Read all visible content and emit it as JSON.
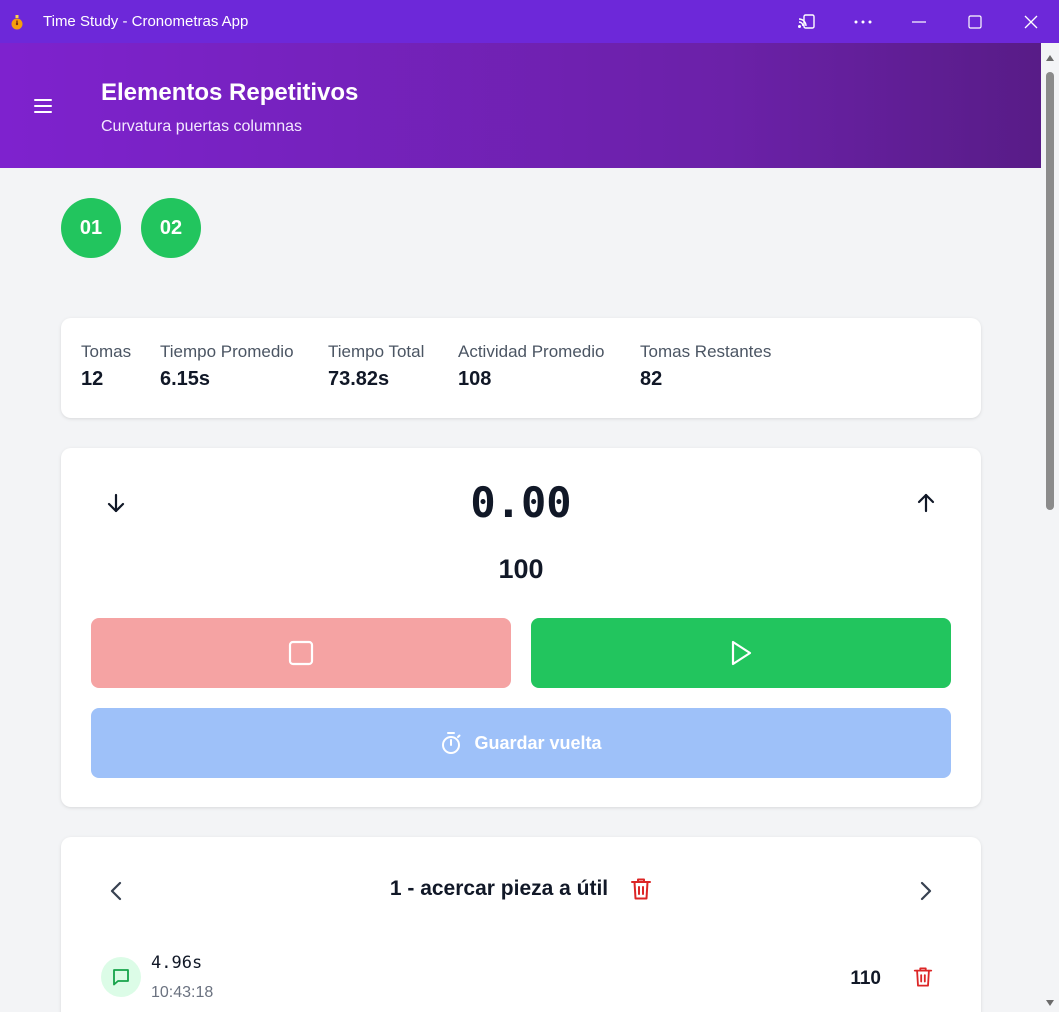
{
  "window": {
    "title": "Time Study - Cronometras App"
  },
  "header": {
    "title": "Elementos Repetitivos",
    "subtitle": "Curvatura puertas columnas"
  },
  "operators": [
    {
      "label": "01"
    },
    {
      "label": "02"
    }
  ],
  "stats": [
    {
      "label": "Tomas",
      "value": "12"
    },
    {
      "label": "Tiempo Promedio",
      "value": "6.15s"
    },
    {
      "label": "Tiempo Total",
      "value": "73.82s"
    },
    {
      "label": "Actividad Promedio",
      "value": "108"
    },
    {
      "label": "Tomas Restantes",
      "value": "82"
    }
  ],
  "timer": {
    "value": "0.00",
    "activity": "100",
    "lap_label": "Guardar vuelta"
  },
  "element": {
    "title": "1 - acercar pieza a útil"
  },
  "laps": [
    {
      "time": "4.96s",
      "clock": "10:43:18",
      "activity": "110"
    }
  ],
  "colors": {
    "titlebar": "#6d28d9",
    "header_gradient_start": "#7e22ce",
    "header_gradient_end": "#581c87",
    "operator_green": "#22c55e",
    "stop_red": "#f5a3a3",
    "play_green": "#22c55e",
    "lap_blue": "#9ec1f9",
    "delete_red": "#dc2626"
  },
  "icons": {
    "app": "stopwatch-app-icon",
    "cast": "cast-icon",
    "more": "more-horizontal-icon",
    "minimize": "minimize-icon",
    "maximize": "maximize-icon",
    "close": "close-icon",
    "menu": "hamburger-icon",
    "arrow_down": "arrow-down-icon",
    "arrow_up": "arrow-up-icon",
    "stop": "stop-square-icon",
    "play": "play-icon",
    "lap": "stopwatch-icon",
    "prev": "chevron-left-icon",
    "next": "chevron-right-icon",
    "trash": "trash-icon",
    "comment": "comment-icon"
  }
}
